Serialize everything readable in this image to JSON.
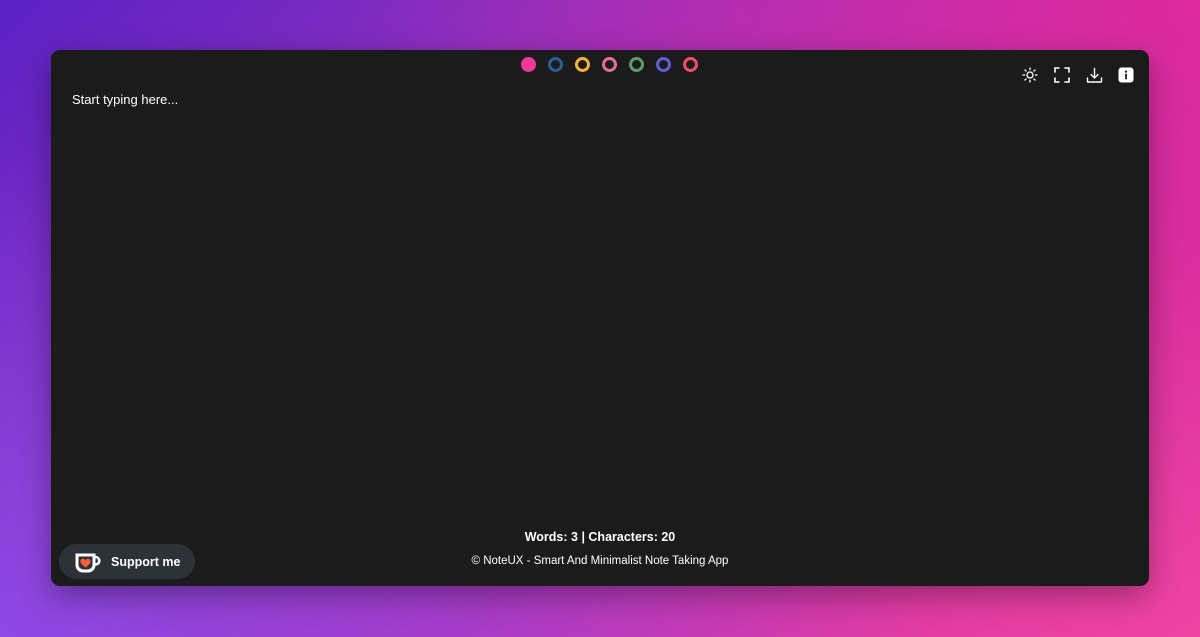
{
  "colors": {
    "swatches": [
      "#f0399a",
      "#2b5e99",
      "#f5b13c",
      "#e36f98",
      "#5d9b6a",
      "#5c5fd6",
      "#f04f6a"
    ],
    "selected_swatch": "#f0399a",
    "panel_bg": "#1b1b1b",
    "support_bg": "#2d3138"
  },
  "toolbar": {
    "icons": [
      "sun-icon",
      "fullscreen-icon",
      "download-icon",
      "info-icon"
    ]
  },
  "editor": {
    "placeholder": "Start typing here...",
    "value": ""
  },
  "stats": {
    "text": "Words: 3 | Characters: 20"
  },
  "footer": {
    "text": "© NoteUX - Smart And Minimalist Note Taking App"
  },
  "support": {
    "label": "Support me",
    "icon": "coffee-cup-heart-icon"
  }
}
